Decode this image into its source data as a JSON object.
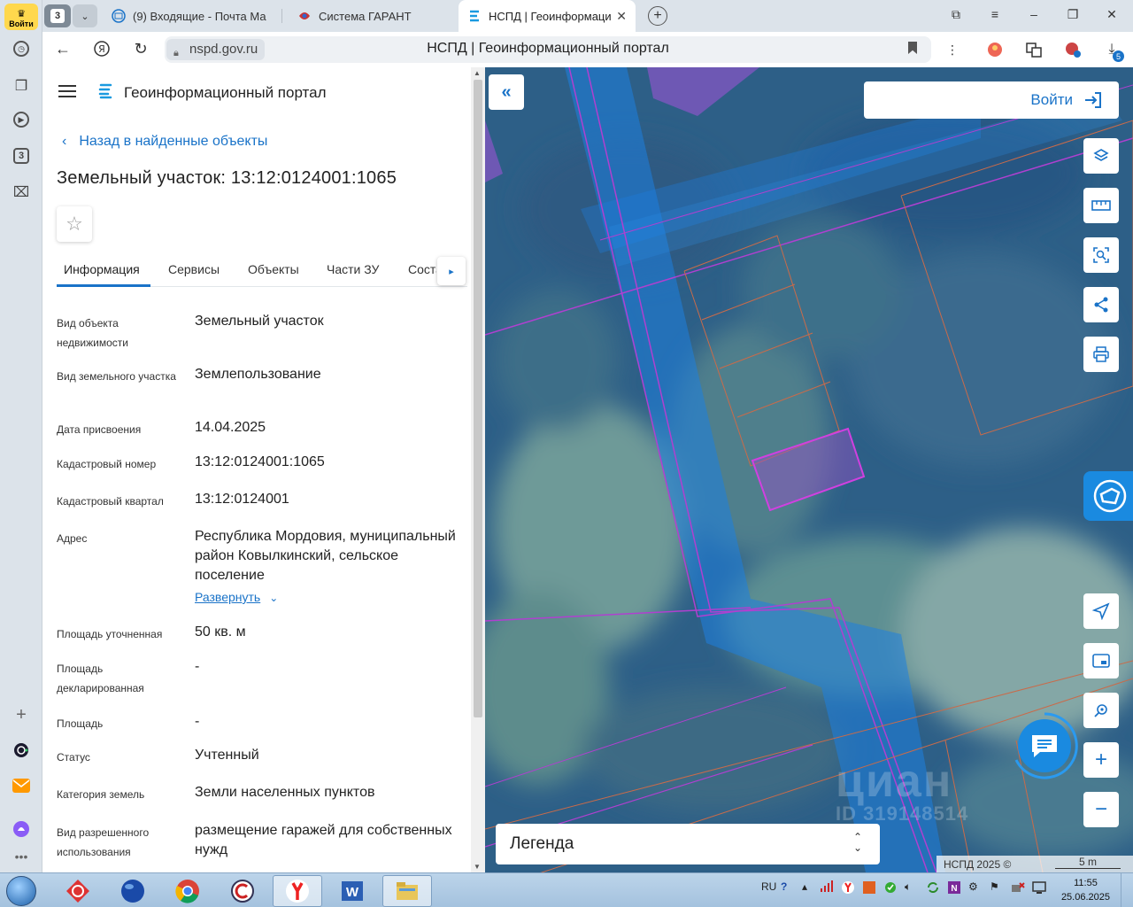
{
  "rail": {
    "login_badge": "Войти",
    "tab_counter": "3"
  },
  "tabs": {
    "count": "3",
    "items": [
      {
        "label": "(9) Входящие - Почта Ма"
      },
      {
        "label": "Система ГАРАНТ"
      },
      {
        "label": "НСПД | Геоинформаци"
      }
    ]
  },
  "address": {
    "domain": "nspd.gov.ru",
    "title": "НСПД | Геоинформационный портал",
    "downloads_badge": "5"
  },
  "panel": {
    "portal_title": "Геоинформационный портал",
    "back_label": "Назад в найденные объекты",
    "object_title": "Земельный участок: 13:12:0124001:1065",
    "tabs": [
      "Информация",
      "Сервисы",
      "Объекты",
      "Части ЗУ",
      "Состав"
    ],
    "rows": [
      {
        "label": "Вид объекта недвижимости",
        "value": "Земельный участок"
      },
      {
        "label": "Вид земельного участка",
        "value": "Землепользование"
      },
      {
        "label": "Дата присвоения",
        "value": "14.04.2025"
      },
      {
        "label": "Кадастровый номер",
        "value": "13:12:0124001:1065"
      },
      {
        "label": "Кадастровый квартал",
        "value": "13:12:0124001"
      },
      {
        "label": "Адрес",
        "value": "Республика Мордовия, муниципальный район Ковылкинский, сельское поселение"
      },
      {
        "label": "Площадь уточненная",
        "value": "50 кв. м"
      },
      {
        "label": "Площадь декларированная",
        "value": "-"
      },
      {
        "label": "Площадь",
        "value": "-"
      },
      {
        "label": "Статус",
        "value": "Учтенный"
      },
      {
        "label": "Категория земель",
        "value": "Земли населенных пунктов"
      },
      {
        "label": "Вид разрешенного использования",
        "value": "размещение гаражей для собственных нужд"
      }
    ],
    "expand_label": "Развернуть"
  },
  "map": {
    "login_label": "Войти",
    "legend_label": "Легенда",
    "copyright": "НСПД 2025 ©",
    "scale_label": "5 m",
    "watermark_brand": "циан",
    "watermark_id": "ID 319148514"
  },
  "taskbar": {
    "lang": "RU",
    "time": "11:55",
    "date": "25.06.2025"
  }
}
